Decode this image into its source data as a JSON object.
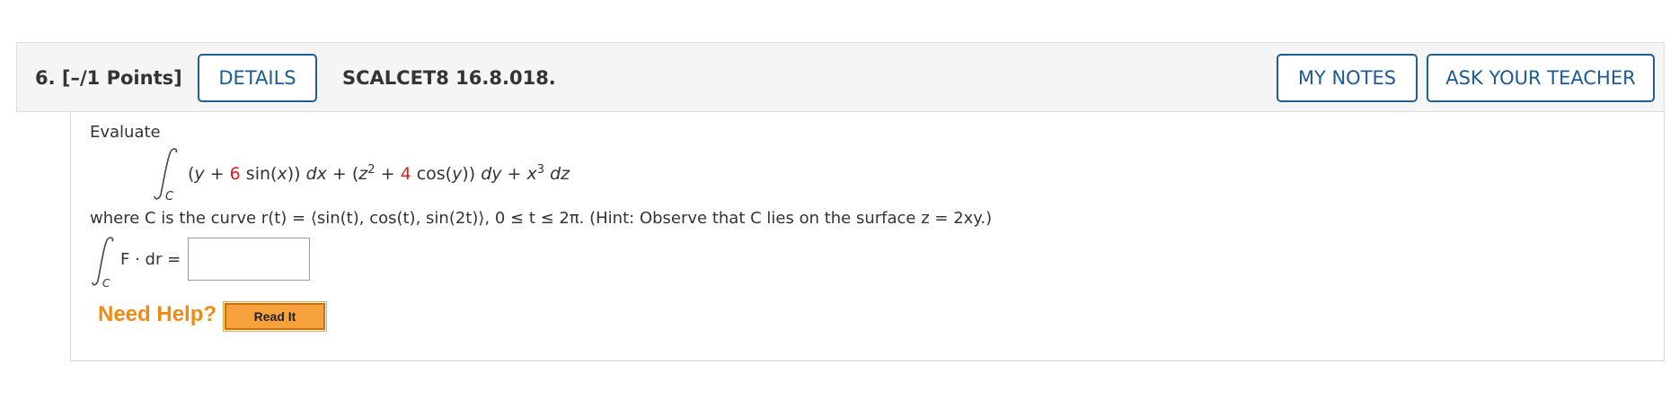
{
  "header": {
    "question_number": "6.",
    "points": "[–/1 Points]",
    "details_label": "DETAILS",
    "problem_code": "SCALCET8 16.8.018.",
    "my_notes_label": "MY NOTES",
    "ask_teacher_label": "ASK YOUR TEACHER"
  },
  "problem": {
    "intro": "Evaluate",
    "integral_subscript": "C",
    "coef_sin": "6",
    "coef_cos": "4",
    "where_text": "where C is the curve r(t) = ⟨sin(t), cos(t), sin(2t)⟩, 0 ≤ t ≤ 2π. (Hint: Observe that C lies on the surface z = 2xy.)",
    "answer_lhs": "F · dr =",
    "answer_value": ""
  },
  "help": {
    "need_help_label": "Need Help?",
    "read_it_label": "Read It"
  },
  "colors": {
    "accent_blue": "#1c5a92",
    "highlight_red": "#e01b1b",
    "help_orange": "#f08a14",
    "button_orange": "#f7a13c"
  }
}
